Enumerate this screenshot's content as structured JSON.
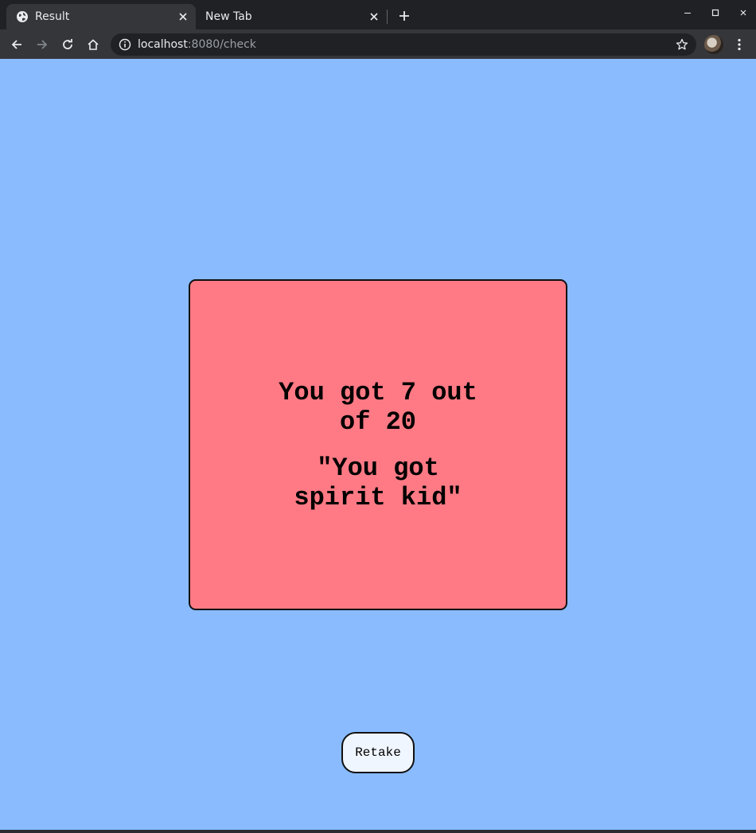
{
  "browser": {
    "tabs": [
      {
        "title": "Result",
        "active": true
      },
      {
        "title": "New Tab",
        "active": false
      }
    ],
    "address": {
      "host": "localhost",
      "path": ":8080/check"
    }
  },
  "page": {
    "background_color": "#89bbfe",
    "card_color": "#ff7a85",
    "score_text": "You got 7 out of 20",
    "quote_text": "\"You got spirit kid\"",
    "retake_label": "Retake"
  }
}
